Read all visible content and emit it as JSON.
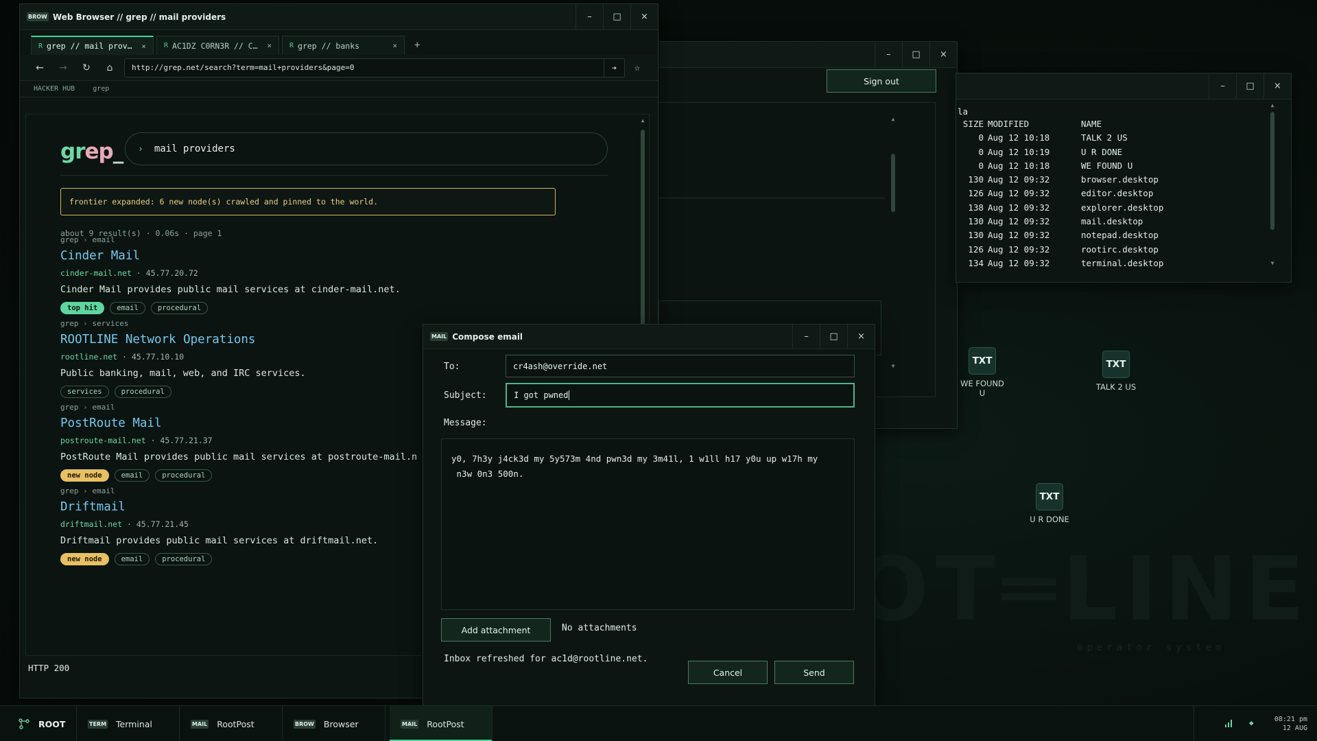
{
  "wallpaper": {
    "brand": "OT═LINE",
    "subtitle": "operator system"
  },
  "browser": {
    "badge": "BROW",
    "title": "Web Browser // grep // mail providers",
    "tabs": [
      {
        "prefix": "R",
        "label": "grep // mail prov…"
      },
      {
        "prefix": "R",
        "label": "AC1DZ C0RN3R // C…"
      },
      {
        "prefix": "R",
        "label": "grep // banks"
      }
    ],
    "url": "http://grep.net/search?term=mail+providers&page=0",
    "bookmarks": [
      "HACKER HUB",
      "grep"
    ],
    "page": {
      "logo": {
        "a": "gr",
        "b": "ep",
        "c": "_"
      },
      "query": "mail providers",
      "notice": "frontier expanded: 6 new node(s) crawled and pinned to the world.",
      "meta": "about 9 result(s) · 0.06s · page 1",
      "results": [
        {
          "crumb_site": "grep",
          "crumb_cat": "email",
          "title": "Cinder Mail",
          "domain": "cinder-mail.net",
          "ip": "45.77.20.72",
          "desc": "Cinder Mail provides public mail services at cinder-mail.net.",
          "tags": [
            {
              "text": "top hit",
              "kind": "tophit"
            },
            {
              "text": "email",
              "kind": "plain"
            },
            {
              "text": "procedural",
              "kind": "plain"
            }
          ]
        },
        {
          "crumb_site": "grep",
          "crumb_cat": "services",
          "title": "ROOTLINE Network Operations",
          "domain": "rootline.net",
          "ip": "45.77.10.10",
          "desc": "Public banking, mail, web, and IRC services.",
          "tags": [
            {
              "text": "services",
              "kind": "plain"
            },
            {
              "text": "procedural",
              "kind": "plain"
            }
          ]
        },
        {
          "crumb_site": "grep",
          "crumb_cat": "email",
          "title": "PostRoute Mail",
          "domain": "postroute-mail.net",
          "ip": "45.77.21.37",
          "desc": "PostRoute Mail provides public mail services at postroute-mail.n",
          "tags": [
            {
              "text": "new node",
              "kind": "newnode"
            },
            {
              "text": "email",
              "kind": "plain"
            },
            {
              "text": "procedural",
              "kind": "plain"
            }
          ]
        },
        {
          "crumb_site": "grep",
          "crumb_cat": "email",
          "title": "Driftmail",
          "domain": "driftmail.net",
          "ip": "45.77.21.45",
          "desc": "Driftmail provides public mail services at driftmail.net.",
          "tags": [
            {
              "text": "new node",
              "kind": "newnode"
            },
            {
              "text": "email",
              "kind": "plain"
            },
            {
              "text": "procedural",
              "kind": "plain"
            }
          ]
        }
      ]
    },
    "status": "HTTP 200"
  },
  "mail_bg": {
    "signout": "Sign out"
  },
  "explorer": {
    "path_fragment": "la",
    "headers": {
      "size": "SIZE",
      "modified": "MODIFIED",
      "name": "NAME"
    },
    "files": [
      {
        "size": "0",
        "modified": "Aug 12 10:18",
        "name": "TALK 2 US"
      },
      {
        "size": "0",
        "modified": "Aug 12 10:19",
        "name": "U R DONE"
      },
      {
        "size": "0",
        "modified": "Aug 12 10:18",
        "name": "WE FOUND U"
      },
      {
        "size": "130",
        "modified": "Aug 12 09:32",
        "name": "browser.desktop"
      },
      {
        "size": "126",
        "modified": "Aug 12 09:32",
        "name": "editor.desktop"
      },
      {
        "size": "138",
        "modified": "Aug 12 09:32",
        "name": "explorer.desktop"
      },
      {
        "size": "130",
        "modified": "Aug 12 09:32",
        "name": "mail.desktop"
      },
      {
        "size": "130",
        "modified": "Aug 12 09:32",
        "name": "notepad.desktop"
      },
      {
        "size": "126",
        "modified": "Aug 12 09:32",
        "name": "rootirc.desktop"
      },
      {
        "size": "134",
        "modified": "Aug 12 09:32",
        "name": "terminal.desktop"
      }
    ]
  },
  "desktop_icons": [
    {
      "tile": "TXT",
      "label_line1": "WE FOUND",
      "label_line2": "U"
    },
    {
      "tile": "TXT",
      "label_line1": "TALK 2 US",
      "label_line2": ""
    },
    {
      "tile": "TXT",
      "label_line1": "U R DONE",
      "label_line2": ""
    }
  ],
  "compose": {
    "badge": "MAIL",
    "title": "Compose email",
    "to_label": "To:",
    "to_value": "cr4ash@override.net",
    "subject_label": "Subject:",
    "subject_value": "I got pwned",
    "message_label": "Message:",
    "message_body": "y0, 7h3y j4ck3d my 5y573m 4nd pwn3d my 3m41l, 1 w1ll h17 y0u up w17h my\n n3w 0n3 500n.",
    "add_attachment": "Add attachment",
    "attachments_status": "No attachments",
    "inbox_status": "Inbox refreshed for ac1d@rootline.net.",
    "cancel": "Cancel",
    "send": "Send"
  },
  "taskbar": {
    "start_label": "ROOT",
    "items": [
      {
        "badge": "TERM",
        "label": "Terminal"
      },
      {
        "badge": "MAIL",
        "label": "RootPost"
      },
      {
        "badge": "BROW",
        "label": "Browser"
      },
      {
        "badge": "MAIL",
        "label": "RootPost"
      }
    ],
    "clock_time": "08:21 pm",
    "clock_date": "12 AUG"
  },
  "window_controls": {
    "minimize": "–",
    "maximize": "□",
    "close": "×"
  },
  "colors": {
    "accent": "#3fd49a",
    "link": "#76c8ee",
    "warning": "#e8c063",
    "background": "#070e0b"
  }
}
